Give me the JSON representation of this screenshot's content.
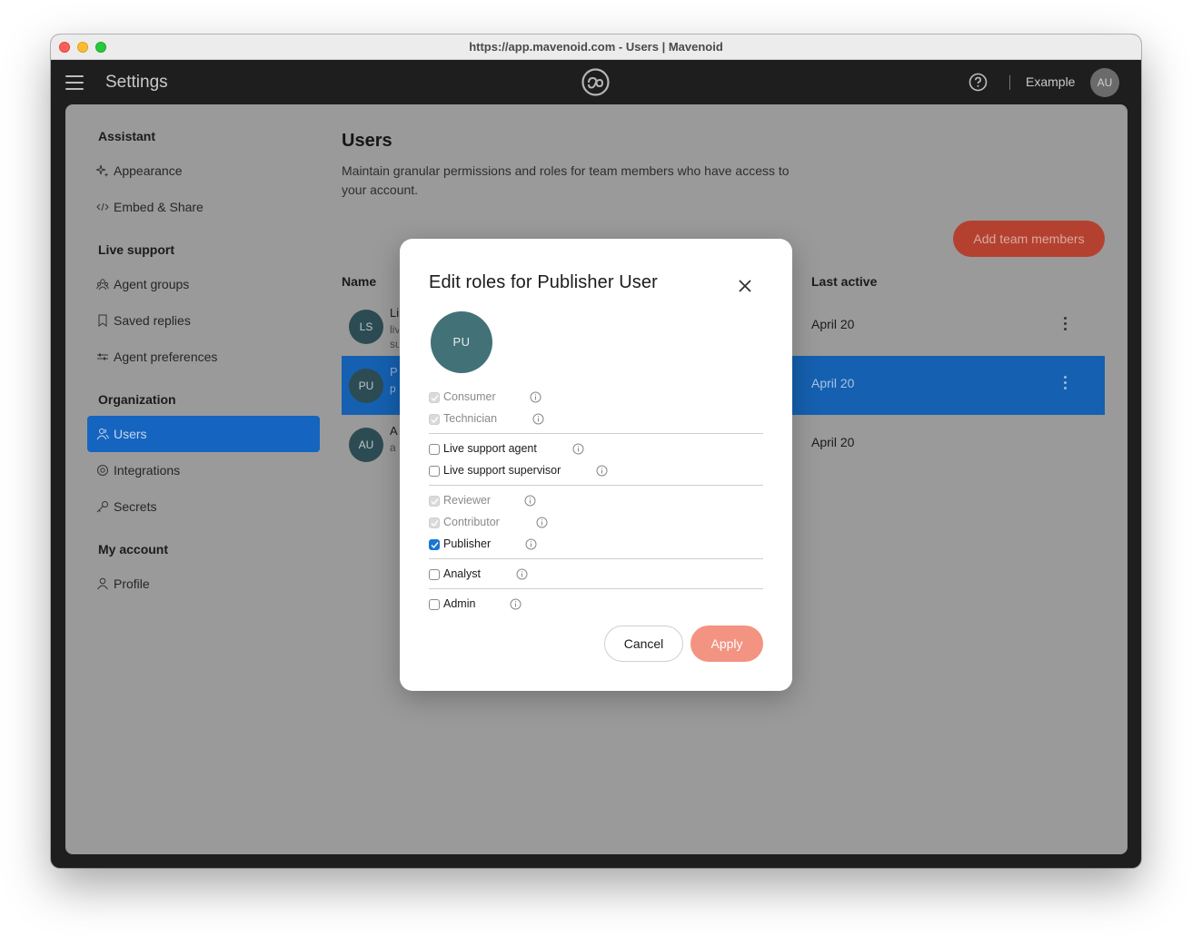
{
  "browser": {
    "url_title": "https://app.mavenoid.com - Users | Mavenoid"
  },
  "appbar": {
    "title": "Settings",
    "org_name": "Example",
    "avatar_initials": "AU"
  },
  "sidebar": {
    "sections": [
      {
        "heading": "Assistant",
        "items": [
          {
            "label": "Appearance",
            "icon": "sparkle-icon"
          },
          {
            "label": "Embed & Share",
            "icon": "code-icon"
          }
        ]
      },
      {
        "heading": "Live support",
        "items": [
          {
            "label": "Agent groups",
            "icon": "group-icon"
          },
          {
            "label": "Saved replies",
            "icon": "bookmark-icon"
          },
          {
            "label": "Agent preferences",
            "icon": "sliders-icon"
          }
        ]
      },
      {
        "heading": "Organization",
        "items": [
          {
            "label": "Users",
            "icon": "users-icon",
            "active": true
          },
          {
            "label": "Integrations",
            "icon": "integrations-icon"
          },
          {
            "label": "Secrets",
            "icon": "key-icon"
          }
        ]
      },
      {
        "heading": "My account",
        "items": [
          {
            "label": "Profile",
            "icon": "user-icon"
          }
        ]
      }
    ]
  },
  "main": {
    "title": "Users",
    "description": "Maintain granular permissions and roles for team members who have access to your account.",
    "add_button": "Add team members",
    "columns": {
      "name": "Name",
      "last_active": "Last active"
    },
    "rows": [
      {
        "initials": "LS",
        "name": "Li",
        "sub": "liv su",
        "last_active": "April 20"
      },
      {
        "initials": "PU",
        "name": "P",
        "sub": "p",
        "last_active": "April 20",
        "selected": true
      },
      {
        "initials": "AU",
        "name": "A",
        "sub": "a",
        "last_active": "April 20"
      }
    ]
  },
  "modal": {
    "title": "Edit roles for Publisher User",
    "avatar_initials": "PU",
    "roles": [
      {
        "label": "Consumer",
        "state": "disabled-checked"
      },
      {
        "label": "Technician",
        "state": "disabled-checked"
      },
      {
        "label": "Live support agent",
        "state": "unchecked"
      },
      {
        "label": "Live support supervisor",
        "state": "unchecked"
      },
      {
        "label": "Reviewer",
        "state": "disabled-checked"
      },
      {
        "label": "Contributor",
        "state": "disabled-checked"
      },
      {
        "label": "Publisher",
        "state": "checked"
      },
      {
        "label": "Analyst",
        "state": "unchecked"
      },
      {
        "label": "Admin",
        "state": "unchecked"
      }
    ],
    "cancel_label": "Cancel",
    "apply_label": "Apply"
  },
  "colors": {
    "active_blue": "#1565c0",
    "apply_salmon": "#f39382",
    "checkbox_blue": "#1976d2",
    "add_button_dimmed": "#b4412f",
    "avatar_teal": "#427177"
  }
}
